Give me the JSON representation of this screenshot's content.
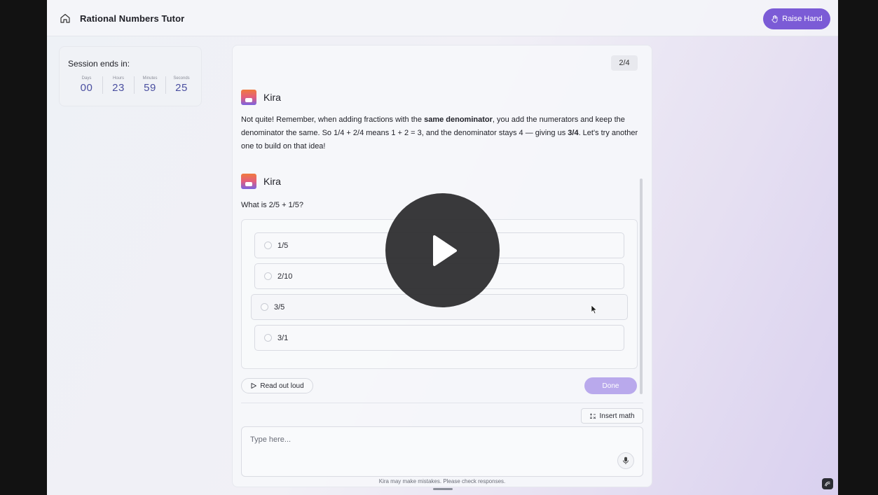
{
  "app": {
    "title": "Rational Numbers Tutor",
    "raise_hand_label": "Raise Hand",
    "accent_color": "#7b5bd6"
  },
  "timer": {
    "label": "Session ends in:",
    "units": [
      {
        "label": "Days",
        "value": "00"
      },
      {
        "label": "Hours",
        "value": "23"
      },
      {
        "label": "Minutes",
        "value": "59"
      },
      {
        "label": "Seconds",
        "value": "25"
      }
    ]
  },
  "chat": {
    "progress": "2/4",
    "messages": [
      {
        "sender": "Kira",
        "text_parts": {
          "p1": "Not quite! Remember, when adding fractions with the ",
          "b1": "same denominator",
          "p2": ", you add the numerators and keep the denominator the same. So 1/4 + 2/4 means 1 + 2 = 3, and the denominator stays 4 — giving us ",
          "b2": "3/4",
          "p3": ". Let's try another one to build on that idea!"
        }
      },
      {
        "sender": "Kira",
        "question": "What is 2/5 + 1/5?"
      }
    ],
    "options": [
      "1/5",
      "2/10",
      "3/5",
      "3/1"
    ],
    "read_aloud_label": "Read out loud",
    "done_label": "Done",
    "insert_math_label": "Insert math",
    "input_placeholder": "Type here...",
    "disclaimer": "Kira may make mistakes. Please check responses."
  },
  "icons": {
    "home": "home-icon",
    "hand": "hand-icon",
    "play": "play-icon",
    "mic": "microphone-icon",
    "math": "math-icon",
    "triangle": "play-small-icon"
  }
}
